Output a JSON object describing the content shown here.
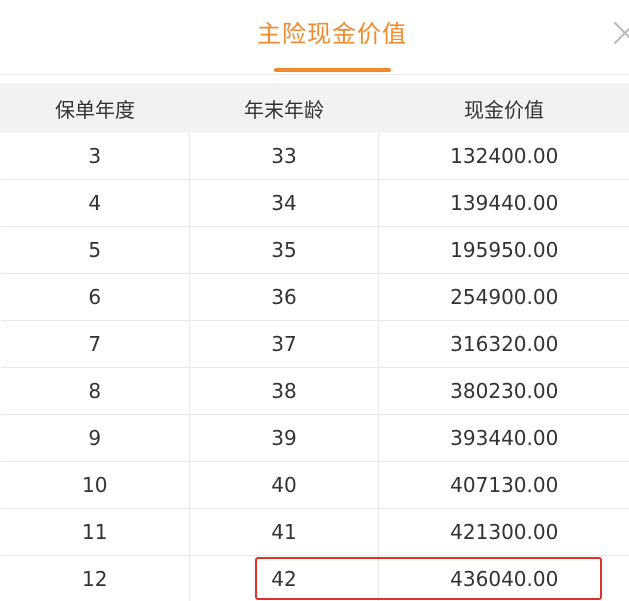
{
  "dialog": {
    "title": "主险现金价值",
    "close_icon": "close-icon"
  },
  "table": {
    "headers": [
      "保单年度",
      "年末年龄",
      "现金价值"
    ],
    "rows": [
      {
        "year": "3",
        "age": "33",
        "value": "132400.00"
      },
      {
        "year": "4",
        "age": "34",
        "value": "139440.00"
      },
      {
        "year": "5",
        "age": "35",
        "value": "195950.00"
      },
      {
        "year": "6",
        "age": "36",
        "value": "254900.00"
      },
      {
        "year": "7",
        "age": "37",
        "value": "316320.00"
      },
      {
        "year": "8",
        "age": "38",
        "value": "380230.00"
      },
      {
        "year": "9",
        "age": "39",
        "value": "393440.00"
      },
      {
        "year": "10",
        "age": "40",
        "value": "407130.00"
      },
      {
        "year": "11",
        "age": "41",
        "value": "421300.00"
      },
      {
        "year": "12",
        "age": "42",
        "value": "436040.00"
      }
    ]
  },
  "colors": {
    "accent": "#f18a2c",
    "highlight_border": "#e0302b",
    "header_bg": "#f2f2f2",
    "text": "#333333"
  }
}
